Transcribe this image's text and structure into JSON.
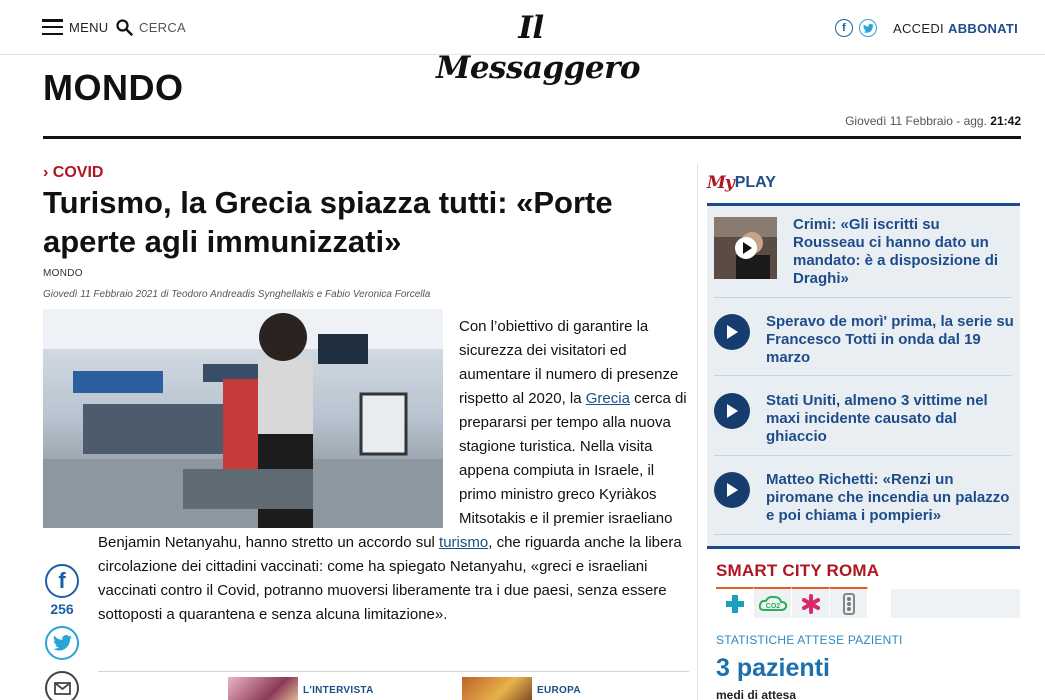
{
  "header": {
    "menu_label": "MENU",
    "search_label": "CERCA",
    "logo_text": "Il Messaggero",
    "facebook_glyph": "f",
    "login_label": "ACCEDI",
    "subscribe_label": "ABBONATI"
  },
  "section": {
    "title": "MONDO",
    "date_prefix": "Giovedì 11 Febbraio - agg.",
    "date_time": "21:42"
  },
  "article": {
    "kicker": "› COVID",
    "headline": "Turismo, la Grecia spiazza tutti: «Porte aperte agli immunizzati»",
    "section_tag": "MONDO",
    "byline": "Giovedì 11 Febbraio 2021 di Teodoro Andreadis Synghellakis e Fabio Veronica Forcella",
    "body_p1_a": "Con l’obiettivo di garantire la sicurezza dei visitatori ed aumentare il numero di presenze rispetto al 2020, la ",
    "body_p1_link": "Grecia",
    "body_p1_b": " cerca di prepararsi per tempo alla nuova stagione turistica. Nella visita appena compiuta in Israele, il primo ministro greco Kyriàkos Mitsotakis e il premier israeliano",
    "body_p2_a": "Benjamin Netanyahu, hanno stretto un accordo sul ",
    "body_p2_link": "turismo",
    "body_p2_b": ", che riguarda anche la libera circolazione dei cittadini vaccinati: come ha spiegato Netanyahu, «greci e israeliani vaccinati contro il Covid, potranno muoversi liberamente tra i due paesi, senza essere sottoposti a quarantena e senza alcuna limitazione».",
    "share_count": "256",
    "related": [
      {
        "label": "L'INTERVISTA"
      },
      {
        "label": "EUROPA"
      }
    ]
  },
  "sidebar": {
    "myplay_logo": "My",
    "myplay_label": "PLAY",
    "videos": [
      {
        "title": "Crimi: «Gli iscritti su Rousseau ci hanno dato un mandato: è a disposizione di Draghi»"
      },
      {
        "title": "Speravo de morì' prima, la serie su Francesco Totti in onda dal 19 marzo"
      },
      {
        "title": "Stati Uniti, almeno 3 vittime nel maxi incidente causato dal ghiaccio"
      },
      {
        "title": "Matteo Richetti: «Renzi un piromane che incendia un palazzo e poi chiama i pompieri»"
      }
    ],
    "smart_city": {
      "title": "SMART CITY ROMA",
      "tabs": [
        {
          "icon": "health-cross-icon",
          "color": "#1a9fbf"
        },
        {
          "icon": "co2-icon",
          "color": "#2cae5a"
        },
        {
          "icon": "asterisk-icon",
          "color": "#d8296d"
        },
        {
          "icon": "traffic-light-icon",
          "color": "#7a7a7a"
        }
      ],
      "co2_label": "CO2",
      "stat_label": "STATISTICHE ATTESE PAZIENTI",
      "stat_value": "3 pazienti",
      "stat_sub": "medi di attesa"
    }
  },
  "colors": {
    "brand_blue": "#1e4c8b",
    "accent_red": "#b01622",
    "facebook": "#1d5fa5",
    "twitter": "#28a4d8"
  }
}
